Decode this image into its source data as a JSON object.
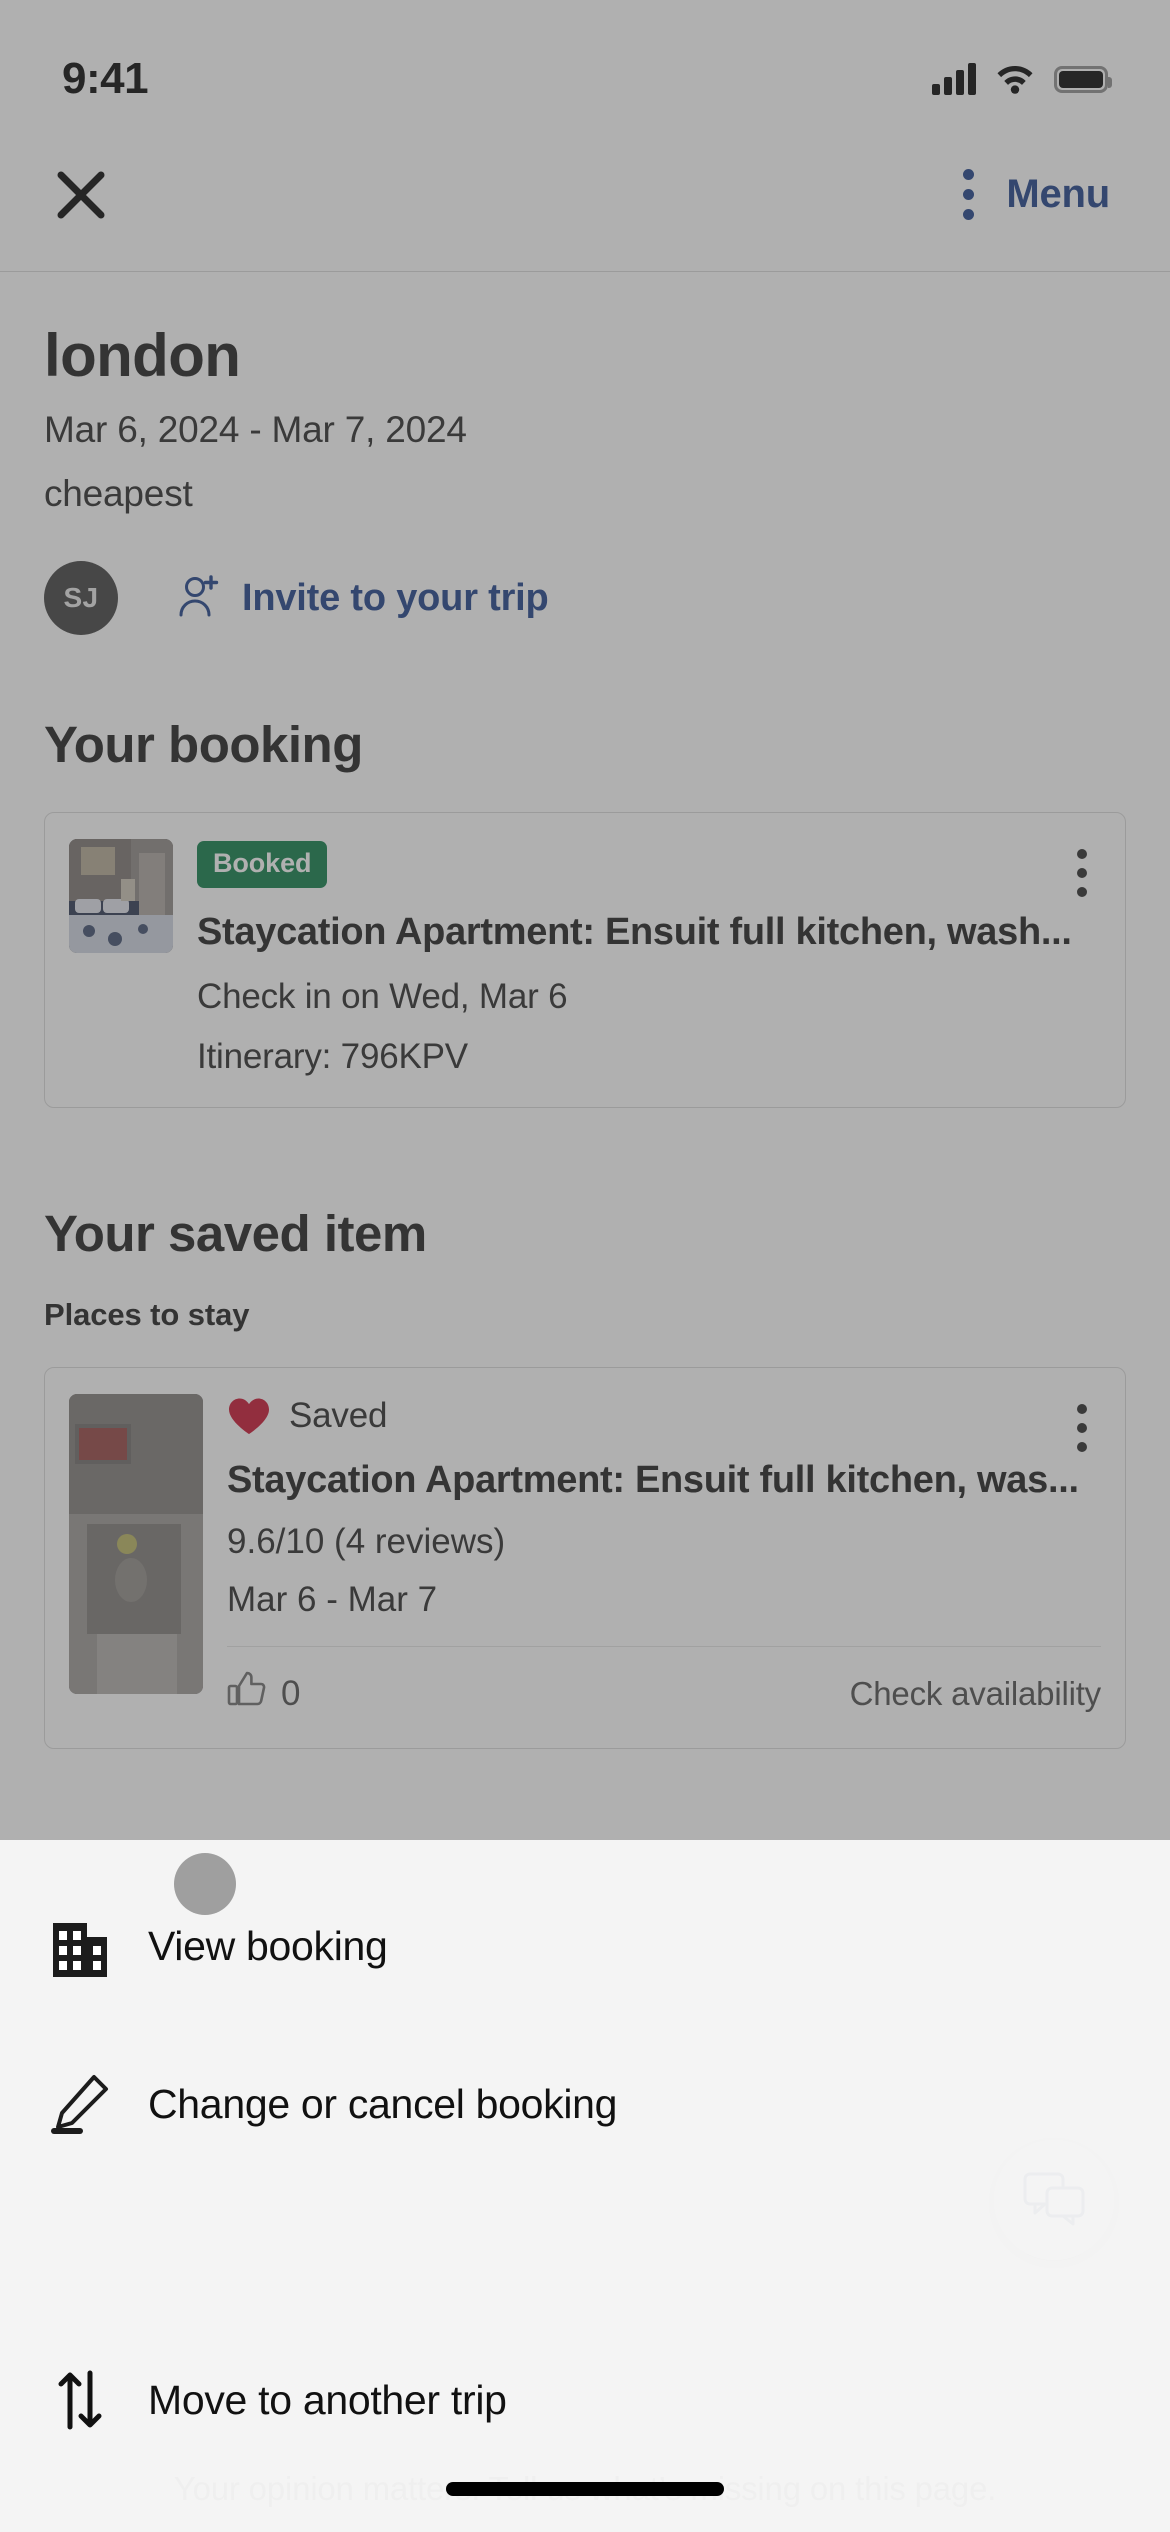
{
  "status_bar": {
    "time": "9:41",
    "signal_icon": "cellular-signal-icon",
    "wifi_icon": "wifi-icon",
    "battery_icon": "battery-icon"
  },
  "nav": {
    "close_icon": "close-icon",
    "kebab_icon": "more-options-icon",
    "menu_label": "Menu"
  },
  "trip": {
    "title": "london",
    "dates": "Mar 6, 2024 - Mar 7, 2024",
    "subtitle": "cheapest",
    "avatar_initials": "SJ",
    "invite_label": "Invite to your trip",
    "invite_icon": "person-add-icon"
  },
  "booking_section": {
    "heading": "Your booking",
    "card": {
      "status_badge": "Booked",
      "title": "Staycation Apartment: Ensuit  full kitchen, wash...",
      "check_in": "Check in on Wed, Mar 6",
      "itinerary": "Itinerary: 796KPV",
      "kebab_icon": "more-options-icon",
      "thumbnail_icon": "bedroom-photo"
    }
  },
  "saved_section": {
    "heading": "Your saved item",
    "subheading": "Places to stay",
    "card": {
      "saved_icon": "heart-icon",
      "saved_label": "Saved",
      "title": "Staycation Apartment: Ensuit  full kitchen, was...",
      "rating": "9.6/10 (4 reviews)",
      "dates": "Mar 6 - Mar 7",
      "thumbs_icon": "thumbs-up-icon",
      "thumbs_count": "0",
      "check_availability": "Check availability",
      "kebab_icon": "more-options-icon",
      "thumbnail_icon": "room-photo"
    }
  },
  "footer": {
    "feedback_text": "Your opinion matters. Tell us what’s missing on this page.",
    "chat_icon": "chat-bubble-icon"
  },
  "action_sheet": {
    "items": [
      {
        "label": "View booking",
        "icon": "building-icon"
      },
      {
        "label": "Change or cancel booking",
        "icon": "pencil-edit-icon"
      },
      {
        "label": "Move to another trip",
        "icon": "move-arrows-icon"
      }
    ]
  },
  "colors": {
    "brand_blue": "#1a3e87",
    "booked_green": "#0a7b45",
    "heart_red": "#c8102e",
    "avatar_gray": "#3d3d3d"
  }
}
